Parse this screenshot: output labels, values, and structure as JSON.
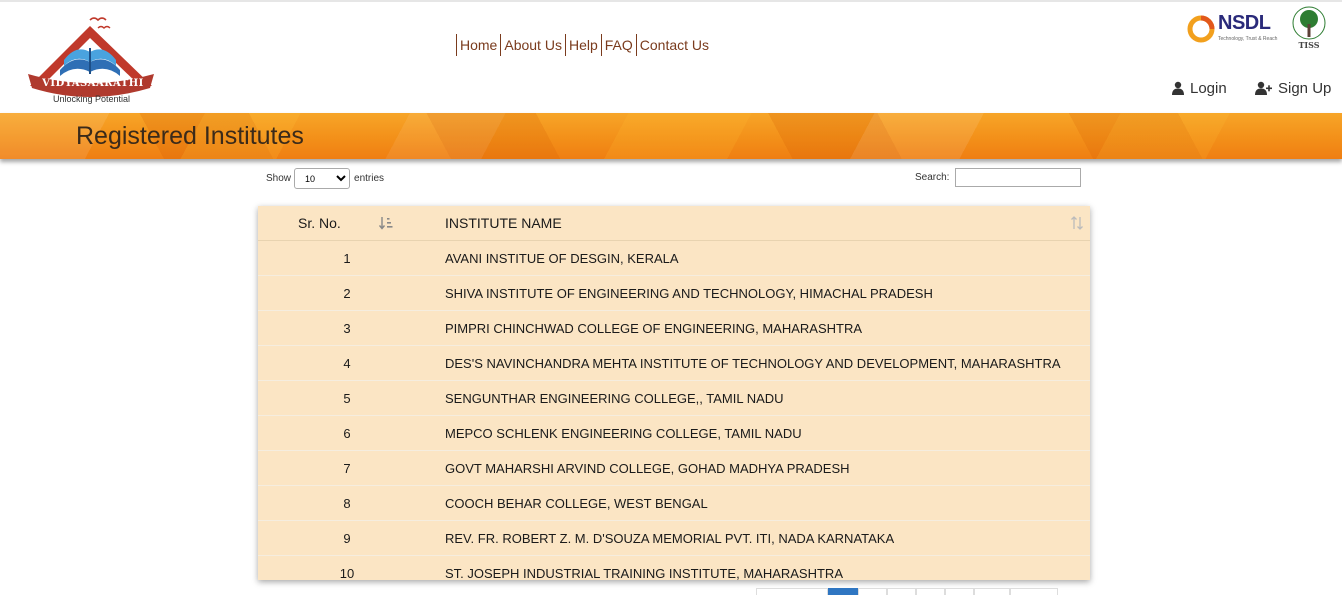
{
  "header": {
    "logo_word": "VIDYASAARATHI",
    "logo_tagline": "Unlocking Potential",
    "nav": [
      "Home",
      "About Us",
      "Help",
      "FAQ",
      "Contact Us"
    ],
    "partners": {
      "nsdl": "NSDL",
      "nsdl_tag": "Technology, Trust & Reach",
      "tiss": "TISS"
    },
    "login_label": "Login",
    "signup_label": "Sign Up"
  },
  "banner": {
    "title": "Registered Institutes"
  },
  "controls": {
    "show_label": "Show",
    "entries_value": "10",
    "entries_label": "entries",
    "search_label": "Search:"
  },
  "table": {
    "headers": [
      "Sr. No.",
      "INSTITUTE NAME"
    ],
    "rows": [
      {
        "sr": "1",
        "name": "AVANI INSTITUE OF DESGIN, KERALA"
      },
      {
        "sr": "2",
        "name": "SHIVA INSTITUTE OF ENGINEERING AND TECHNOLOGY, HIMACHAL PRADESH"
      },
      {
        "sr": "3",
        "name": "PIMPRI CHINCHWAD COLLEGE OF ENGINEERING, MAHARASHTRA"
      },
      {
        "sr": "4",
        "name": "DES'S NAVINCHANDRA MEHTA INSTITUTE OF TECHNOLOGY AND DEVELOPMENT, MAHARASHTRA"
      },
      {
        "sr": "5",
        "name": "SENGUNTHAR ENGINEERING COLLEGE,, TAMIL NADU"
      },
      {
        "sr": "6",
        "name": "MEPCO SCHLENK ENGINEERING COLLEGE, TAMIL NADU"
      },
      {
        "sr": "7",
        "name": "GOVT MAHARSHI ARVIND COLLEGE, GOHAD MADHYA PRADESH"
      },
      {
        "sr": "8",
        "name": "COOCH BEHAR COLLEGE, WEST BENGAL"
      },
      {
        "sr": "9",
        "name": "REV. FR. ROBERT Z. M. D'SOUZA MEMORIAL PVT. ITI, NADA KARNATAKA"
      },
      {
        "sr": "10",
        "name": "ST. JOSEPH  INDUSTRIAL TRAINING INSTITUTE, MAHARASHTRA"
      }
    ]
  },
  "colors": {
    "brand_brown": "#7a3b1d",
    "banner_orange": "#f39019",
    "row_bg": "#fbe5c4",
    "pager_active": "#2f76c2"
  }
}
